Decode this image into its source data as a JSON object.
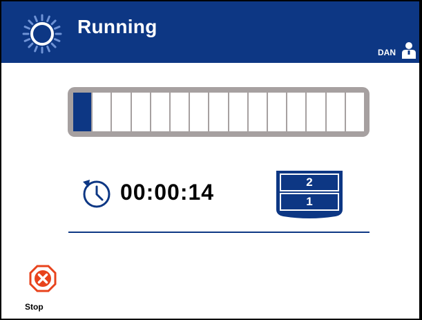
{
  "header": {
    "title": "Running",
    "status_icon": "spinner-icon",
    "user": {
      "name": "DAN",
      "icon": "user-icon"
    }
  },
  "progress": {
    "segments_total": 15,
    "segments_filled": 1,
    "fill_color": "#0d3784",
    "frame_color": "#a6a0a0"
  },
  "timer": {
    "icon": "clock-icon",
    "value": "00:00:14"
  },
  "tray": {
    "icon": "tray-icon",
    "top_label": "2",
    "bottom_label": "1"
  },
  "actions": {
    "stop_label": "Stop",
    "stop_icon": "close-icon",
    "stop_color": "#e8431c"
  },
  "colors": {
    "header_bg": "#0d3784",
    "accent": "#0d3784"
  }
}
